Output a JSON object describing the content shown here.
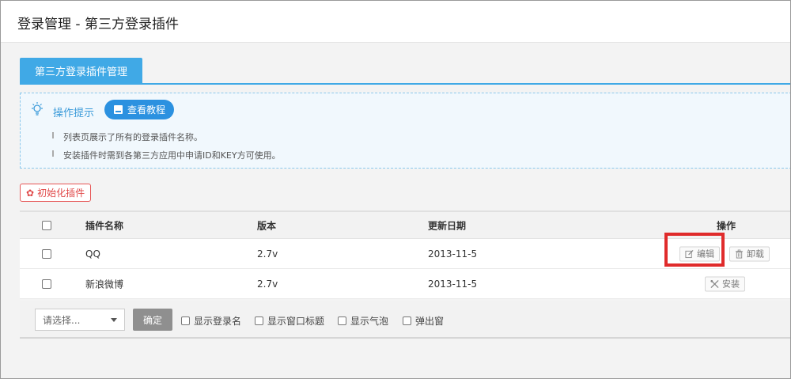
{
  "page": {
    "title": "登录管理 - 第三方登录插件"
  },
  "tabs": [
    {
      "label": "第三方登录插件管理"
    }
  ],
  "tips": {
    "title": "操作提示",
    "tutorial_label": "查看教程",
    "lines": [
      "列表页展示了所有的登录插件名称。",
      "安装插件时需到各第三方应用中申请ID和KEY方可使用。"
    ]
  },
  "toolbar": {
    "init_label": "初始化插件"
  },
  "table": {
    "headers": {
      "name": "插件名称",
      "version": "版本",
      "date": "更新日期",
      "actions": "操作"
    },
    "rows": [
      {
        "name": "QQ",
        "version": "2.7v",
        "date": "2013-11-5",
        "actions": [
          "编辑",
          "卸载"
        ]
      },
      {
        "name": "新浪微博",
        "version": "2.7v",
        "date": "2013-11-5",
        "actions": [
          "安装"
        ]
      }
    ]
  },
  "footer": {
    "select_placeholder": "请选择...",
    "confirm_label": "确定",
    "options": [
      "显示登录名",
      "显示窗口标题",
      "显示气泡",
      "弹出窗"
    ]
  },
  "colors": {
    "accent": "#40a9e6",
    "danger": "#e04848",
    "highlight": "#e02b2b"
  }
}
